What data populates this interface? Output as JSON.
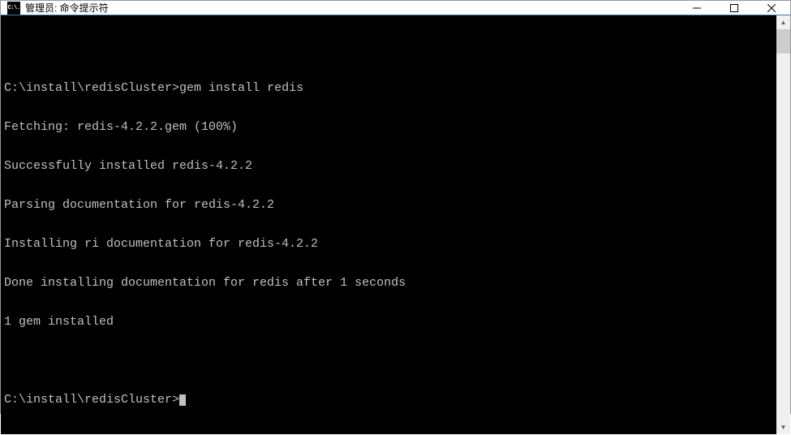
{
  "window": {
    "icon_text": "C:\\.",
    "title": "管理员: 命令提示符"
  },
  "terminal": {
    "blank_top": "",
    "line1_prompt": "C:\\install\\redisCluster>",
    "line1_cmd": "gem install redis",
    "line2": "Fetching: redis-4.2.2.gem (100%)",
    "line3": "Successfully installed redis-4.2.2",
    "line4": "Parsing documentation for redis-4.2.2",
    "line5": "Installing ri documentation for redis-4.2.2",
    "line6": "Done installing documentation for redis after 1 seconds",
    "line7": "1 gem installed",
    "blank_mid": "",
    "line8_prompt": "C:\\install\\redisCluster>"
  }
}
